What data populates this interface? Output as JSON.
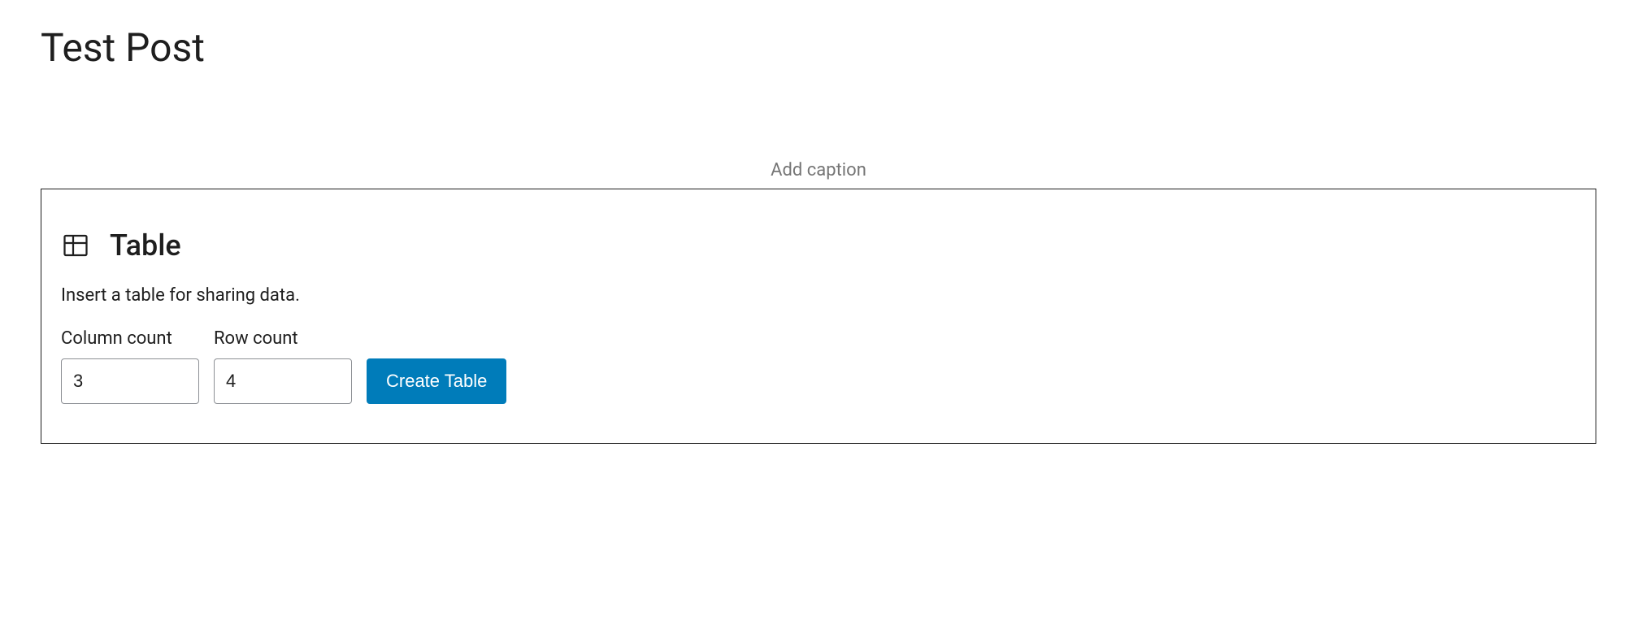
{
  "post": {
    "title": "Test Post"
  },
  "caption": {
    "placeholder": "Add caption"
  },
  "block": {
    "title": "Table",
    "description": "Insert a table for sharing data.",
    "columnCount": {
      "label": "Column count",
      "value": "3"
    },
    "rowCount": {
      "label": "Row count",
      "value": "4"
    },
    "createButton": "Create Table"
  }
}
